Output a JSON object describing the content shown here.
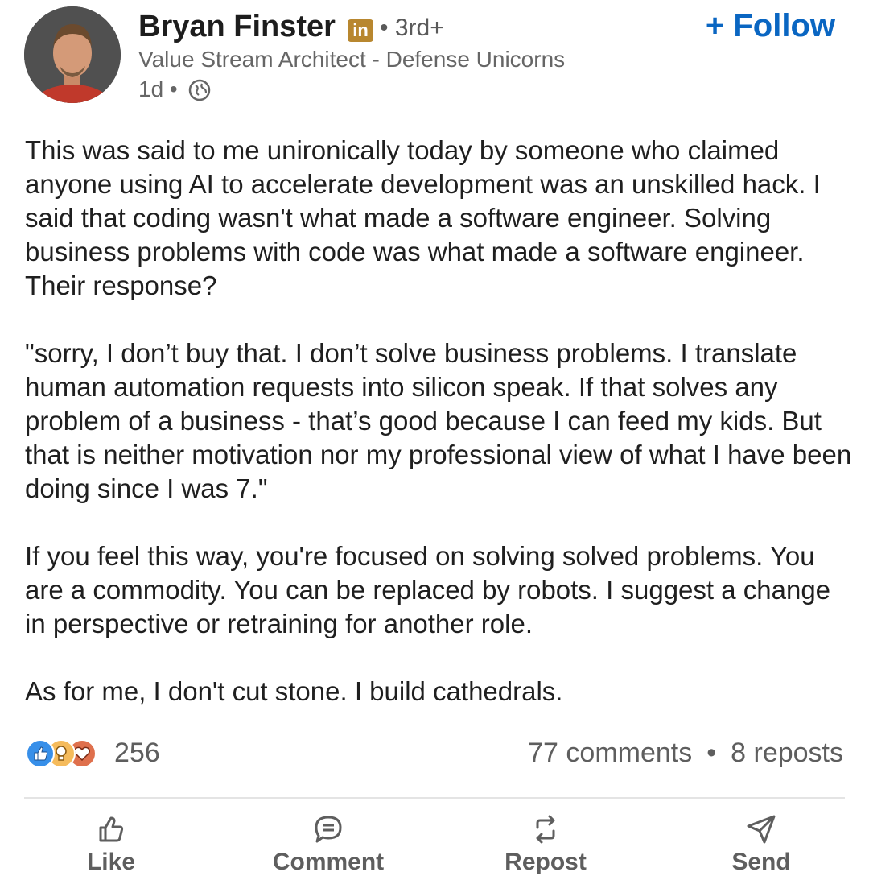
{
  "post": {
    "author": {
      "name": "Bryan Finster",
      "badge": "in",
      "degree": "• 3rd+",
      "headline": "Value Stream Architect - Defense Unicorns",
      "age": "1d •"
    },
    "follow_label": "+ Follow",
    "paragraphs": [
      "This was said to me unironically today by someone who claimed anyone using AI to accelerate development was an unskilled hack. I said that coding wasn't what made a software engineer. Solving business problems with code was what made a software engineer. Their response?",
      "\"sorry, I don’t buy that. I don’t solve business problems. I translate human automation requests into silicon speak. If that solves any problem of a business - that’s good because I can feed my kids. But that is neither motivation nor my professional view of what I have been doing since I was 7.\"",
      "If you feel this way, you're focused on solving solved problems. You are a commodity. You can be replaced by robots. I suggest a change in perspective or retraining for another role.",
      "As for me, I don't cut stone. I build cathedrals."
    ],
    "reactions": {
      "icons": [
        "like-icon",
        "insightful-icon",
        "love-icon"
      ],
      "count": "256"
    },
    "comments": "77 comments",
    "separator": "•",
    "reposts": "8 reposts"
  },
  "actions": {
    "like": "Like",
    "comment": "Comment",
    "repost": "Repost",
    "send": "Send"
  },
  "colors": {
    "accent": "#0a66c2",
    "badge": "#b8872f",
    "like": "#378fe9",
    "insightful": "#f5bb5c",
    "love": "#df704d"
  }
}
